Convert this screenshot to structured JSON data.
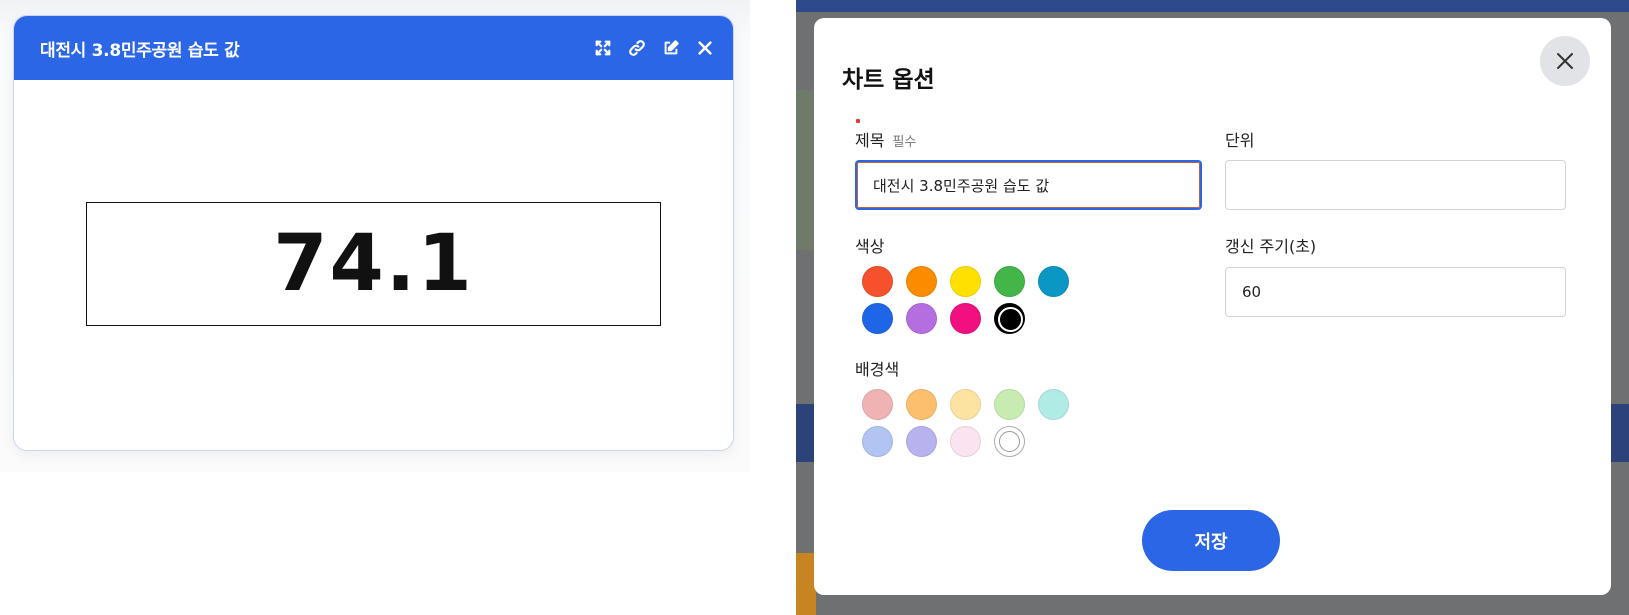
{
  "widget": {
    "title": "대전시 3.8민주공원 습도 값",
    "value": "74.1",
    "actions": [
      "expand-icon",
      "link-icon",
      "edit-icon",
      "close-icon"
    ]
  },
  "modal": {
    "title": "차트 옵션",
    "title_field": {
      "label": "제목",
      "required_label": "필수",
      "value": "대전시 3.8민주공원 습도 값"
    },
    "unit_field": {
      "label": "단위",
      "value": ""
    },
    "color_label": "색상",
    "colors": [
      "#f4512c",
      "#fb8c00",
      "#ffe000",
      "#43b649",
      "#0a97c4",
      "#1e66e6",
      "#b56ee0",
      "#f0107f",
      "#000000"
    ],
    "selected_color_index": 8,
    "bg_color_label": "배경색",
    "bg_colors": [
      "#f0b3b3",
      "#fbbf6e",
      "#fde3a2",
      "#c7ebb0",
      "#b1ebe5",
      "#b1c4f2",
      "#b8b2ee",
      "#fbe3ef",
      "#ffffff"
    ],
    "selected_bg_index": 8,
    "refresh_field": {
      "label": "갱신 주기(초)",
      "value": "60"
    },
    "save_label": "저장"
  }
}
